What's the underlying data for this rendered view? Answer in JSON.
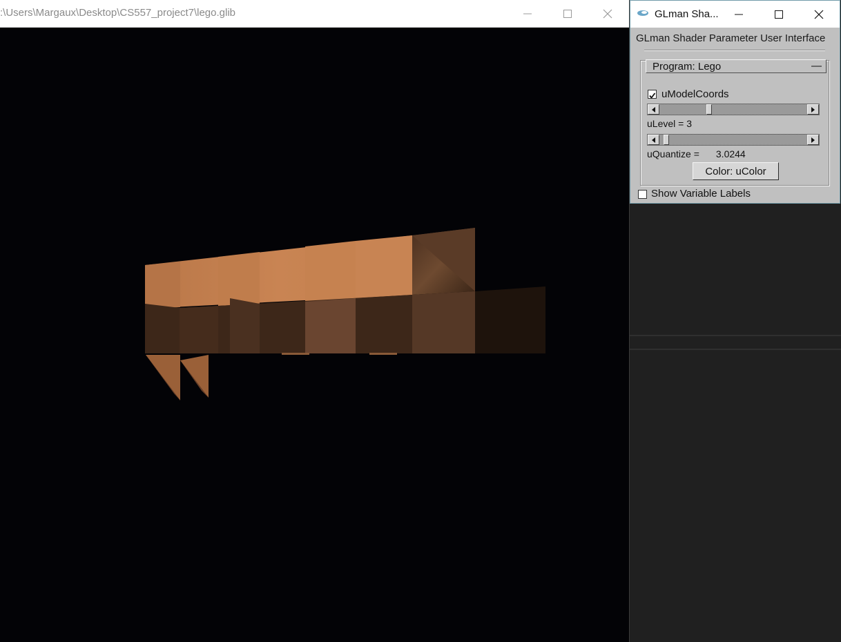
{
  "render_window": {
    "title": ":\\Users\\Margaux\\Desktop\\CS557_project7\\lego.glib",
    "controls": {
      "minimize": "minimize-icon",
      "maximize": "maximize-icon",
      "close": "close-icon"
    },
    "background_color": "#030306",
    "model_color": "#c2804f"
  },
  "param_window": {
    "title": "GLman Sha...",
    "heading": "GLman Shader Parameter User Interface",
    "program_label": "Program: Lego",
    "collapse_glyph": "—",
    "model_coords": {
      "label": "uModelCoords",
      "checked": true
    },
    "ulevel": {
      "text": "uLevel = 3",
      "slider_fraction": 0.33
    },
    "uquantize": {
      "label": "uQuantize =",
      "value": "3.0244",
      "slider_fraction": 0.03
    },
    "color_button": "Color: uColor",
    "show_labels": {
      "label": "Show Variable Labels",
      "checked": false
    }
  }
}
